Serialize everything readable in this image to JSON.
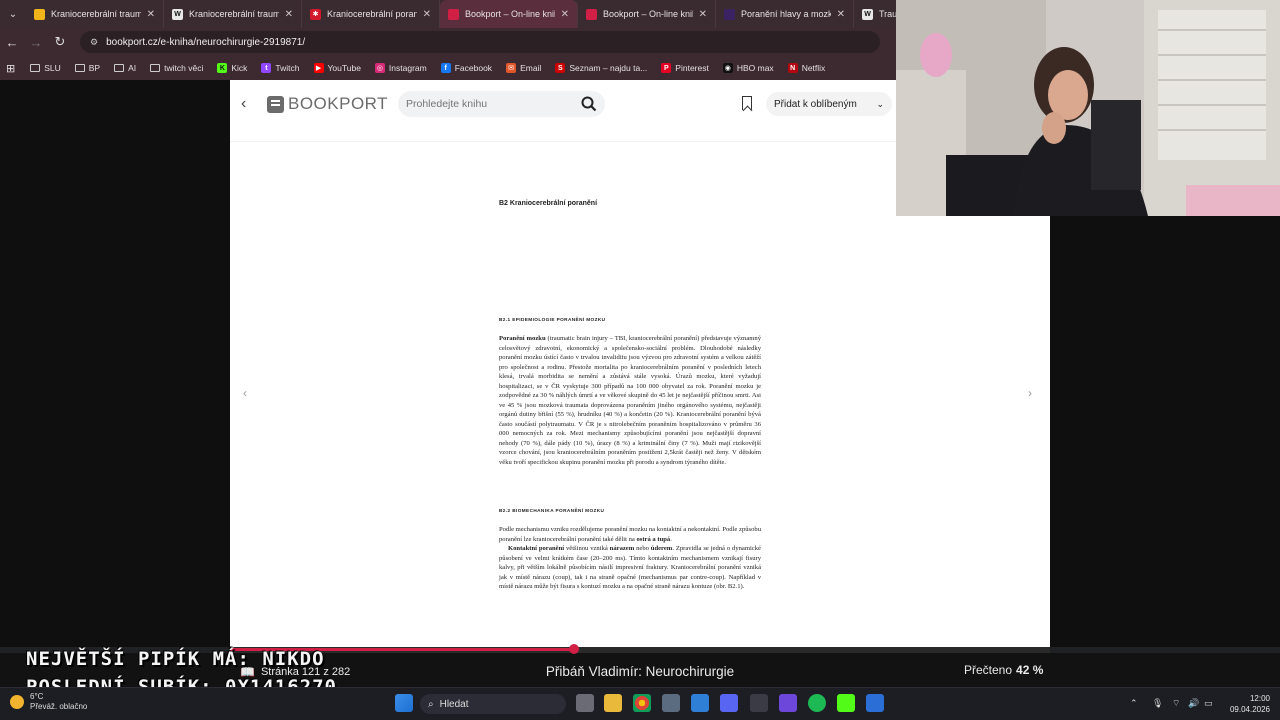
{
  "browser": {
    "tabs": [
      {
        "title": "Kraniocerebrální traumata",
        "favicon_color": "#f2b41b",
        "favicon_letter": ""
      },
      {
        "title": "Kraniocerebrální traumata",
        "favicon_color": "#e8e8e8",
        "favicon_letter": "W"
      },
      {
        "title": "Kraniocerebrální poranění",
        "favicon_color": "#d2182c",
        "favicon_letter": "✱"
      },
      {
        "title": "Bookport – On-line knihov",
        "favicon_color": "#d21f46",
        "favicon_letter": "",
        "active": true
      },
      {
        "title": "Bookport – On-line knihov",
        "favicon_color": "#d21f46",
        "favicon_letter": ""
      },
      {
        "title": "Poranění hlavy a mozku |",
        "favicon_color": "#3b2262",
        "favicon_letter": ""
      },
      {
        "title": "Trau",
        "favicon_color": "#e8e8e8",
        "favicon_letter": "W"
      }
    ],
    "url": "bookport.cz/e-kniha/neurochirurgie-2919871/",
    "bookmarks": [
      {
        "label": "SLU",
        "type": "folder"
      },
      {
        "label": "BP",
        "type": "folder"
      },
      {
        "label": "AI",
        "type": "folder"
      },
      {
        "label": "twitch věci",
        "type": "folder"
      },
      {
        "label": "Kick",
        "type": "site",
        "color": "#53fc18",
        "letter": "K"
      },
      {
        "label": "Twitch",
        "type": "site",
        "color": "#9146ff",
        "letter": "t"
      },
      {
        "label": "YouTube",
        "type": "site",
        "color": "#ff0000",
        "letter": "▶"
      },
      {
        "label": "Instagram",
        "type": "site",
        "color": "#d62976",
        "letter": "◎"
      },
      {
        "label": "Facebook",
        "type": "site",
        "color": "#1877f2",
        "letter": "f"
      },
      {
        "label": "Email",
        "type": "site",
        "color": "#e2572a",
        "letter": "✉"
      },
      {
        "label": "Seznam – najdu ta...",
        "type": "site",
        "color": "#cc0000",
        "letter": "S"
      },
      {
        "label": "Pinterest",
        "type": "site",
        "color": "#e60023",
        "letter": "P"
      },
      {
        "label": "HBO max",
        "type": "site",
        "color": "#111111",
        "letter": "◉"
      },
      {
        "label": "Netflix",
        "type": "site",
        "color": "#b20710",
        "letter": "N"
      }
    ]
  },
  "reader": {
    "brand": "BOOKPORT",
    "search_placeholder": "Prohledejte knihu",
    "favorite_button": "Přidat k oblíbeným",
    "chapter_heading": "B2  Kraniocerebrální poranění",
    "section1_heading": "B2.1 EPIDEMIOLOGIE PORANĚNÍ MOZKU",
    "section1_text": "Poranění mozku (traumatic brain injury – TBI, kraniocerebrální poranění) představuje významný celosvětový zdravotní, ekonomický a společensko-sociální problém. Dlouhodobé následky poranění mozku ústící často v trvalou invaliditu jsou výzvou pro zdravotní systém a velkou zátěží pro společnost a rodinu. Přestože mortalita po kraniocerebrálním poranění v posledních letech klesá, trvalá morbidita se nemění a zůstává stále vysoká. Úrazů mozku, které vyžadují hospitalizaci, se v ČR vyskytuje 300 případů na 100 000 obyvatel za rok. Poranění mozku je zodpovědné za 30 % náhlých úmrtí a ve věkové skupině do 45 let je nejčastější příčinou smrti. Asi ve 45 % jsou mozková traumata doprovázena poraněním jiného orgánového systému, nejčastěji orgánů dutiny břišní (55 %), hrudníku (40 %) a končetin (20 %). Kraniocerebrální poranění bývá často součástí polytraumatu. V ČR je s nitrolebečním poraněním hospitalizováno v průměru 36 000 nemocných za rok. Mezi mechanismy způsobujícími poranění jsou nejčastější dopravní nehody (70 %), dále pády (10 %), úrazy (8 %) a kriminální činy (7 %). Muži mají rizikovější vzorce chování, jsou kraniocerebrálním poraněním postiženi 2,5krát častěji než ženy. V dětském věku tvoří specifickou skupinu poranění mozku při porodu a syndrom týraného dítěte.",
    "section2_heading": "B2.2 BIOMECHANIKA PORANĚNÍ MOZKU",
    "section2_text1": "Podle mechanismu vzniku rozdělujeme poranění mozku na kontaktní a nekontaktní. Podle způsobu poranění lze kraniocerebrální poranění také dělit na ostrá a tupá.",
    "section2_text2": "Kontaktní poranění většinou vzniká nárazem nebo úderem. Zpravidla se jedná o dynamické působení ve velmi krátkém čase (20–200 ms). Tímto kontaktním mechanismem vznikají fisury kalvy, při větším lokálně působícím násilí impresivní fraktury. Kraniocerebrální poranění vzniká jak v místě nárazu (coup), tak i na straně opačné (mechanismus par contre-coup). Například v místě nárazu může být fisura s kontuzí mozku a na opačné straně nárazu kontuze (obr. B2.1).",
    "page_status": "Stránka 121 z 282",
    "book_title": "Přibáň Vladimír: Neurochirurgie",
    "read_label": "Přečteno",
    "read_percent": "42 %",
    "progress_fraction": 0.42
  },
  "overlay": {
    "line1": "NEJVĚTŠÍ PIPÍK MÁ: NIKDO",
    "line2": "POSLEDNÍ SUBÍK: 0X1416270"
  },
  "taskbar": {
    "temperature": "6°C",
    "weather": "Převáž. oblačno",
    "search_placeholder": "Hledat",
    "time": "12:00",
    "date": "09.04.2026"
  }
}
